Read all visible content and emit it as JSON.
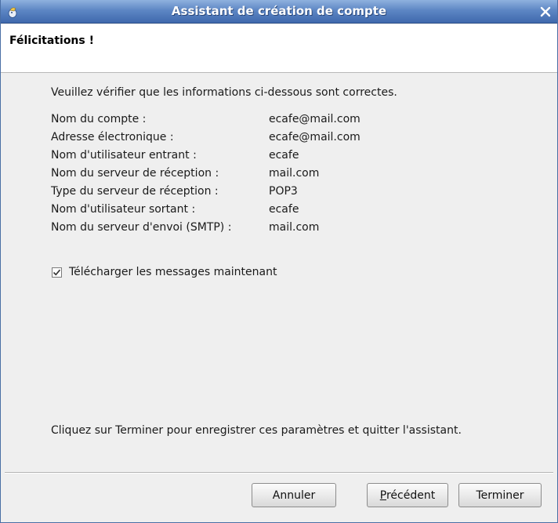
{
  "window": {
    "title": "Assistant de création de compte",
    "icon": "mail-app-icon",
    "close_icon": "close-icon"
  },
  "header": {
    "title": "Félicitations !"
  },
  "content": {
    "intro": "Veuillez vérifier que les informations ci-dessous sont correctes.",
    "rows": [
      {
        "label": "Nom du compte :",
        "value": "ecafe@mail.com"
      },
      {
        "label": "Adresse électronique :",
        "value": "ecafe@mail.com"
      },
      {
        "label": "Nom d'utilisateur entrant :",
        "value": "ecafe"
      },
      {
        "label": "Nom du serveur de réception :",
        "value": "mail.com"
      },
      {
        "label": "Type du serveur de réception :",
        "value": "POP3"
      },
      {
        "label": "Nom d'utilisateur sortant :",
        "value": "ecafe"
      },
      {
        "label": "Nom du serveur d'envoi (SMTP) :",
        "value": "mail.com"
      }
    ],
    "download_checkbox": {
      "label": "Télécharger les messages maintenant",
      "checked": true
    },
    "footer": "Cliquez sur Terminer pour enregistrer ces paramètres et quitter l'assistant."
  },
  "buttons": {
    "cancel": "Annuler",
    "prev_mnemonic": "P",
    "prev_rest": "récédent",
    "finish": "Terminer"
  },
  "colors": {
    "titlebar": "#5d86c4",
    "header_bg": "#ffffff",
    "window_bg": "#efefef"
  }
}
